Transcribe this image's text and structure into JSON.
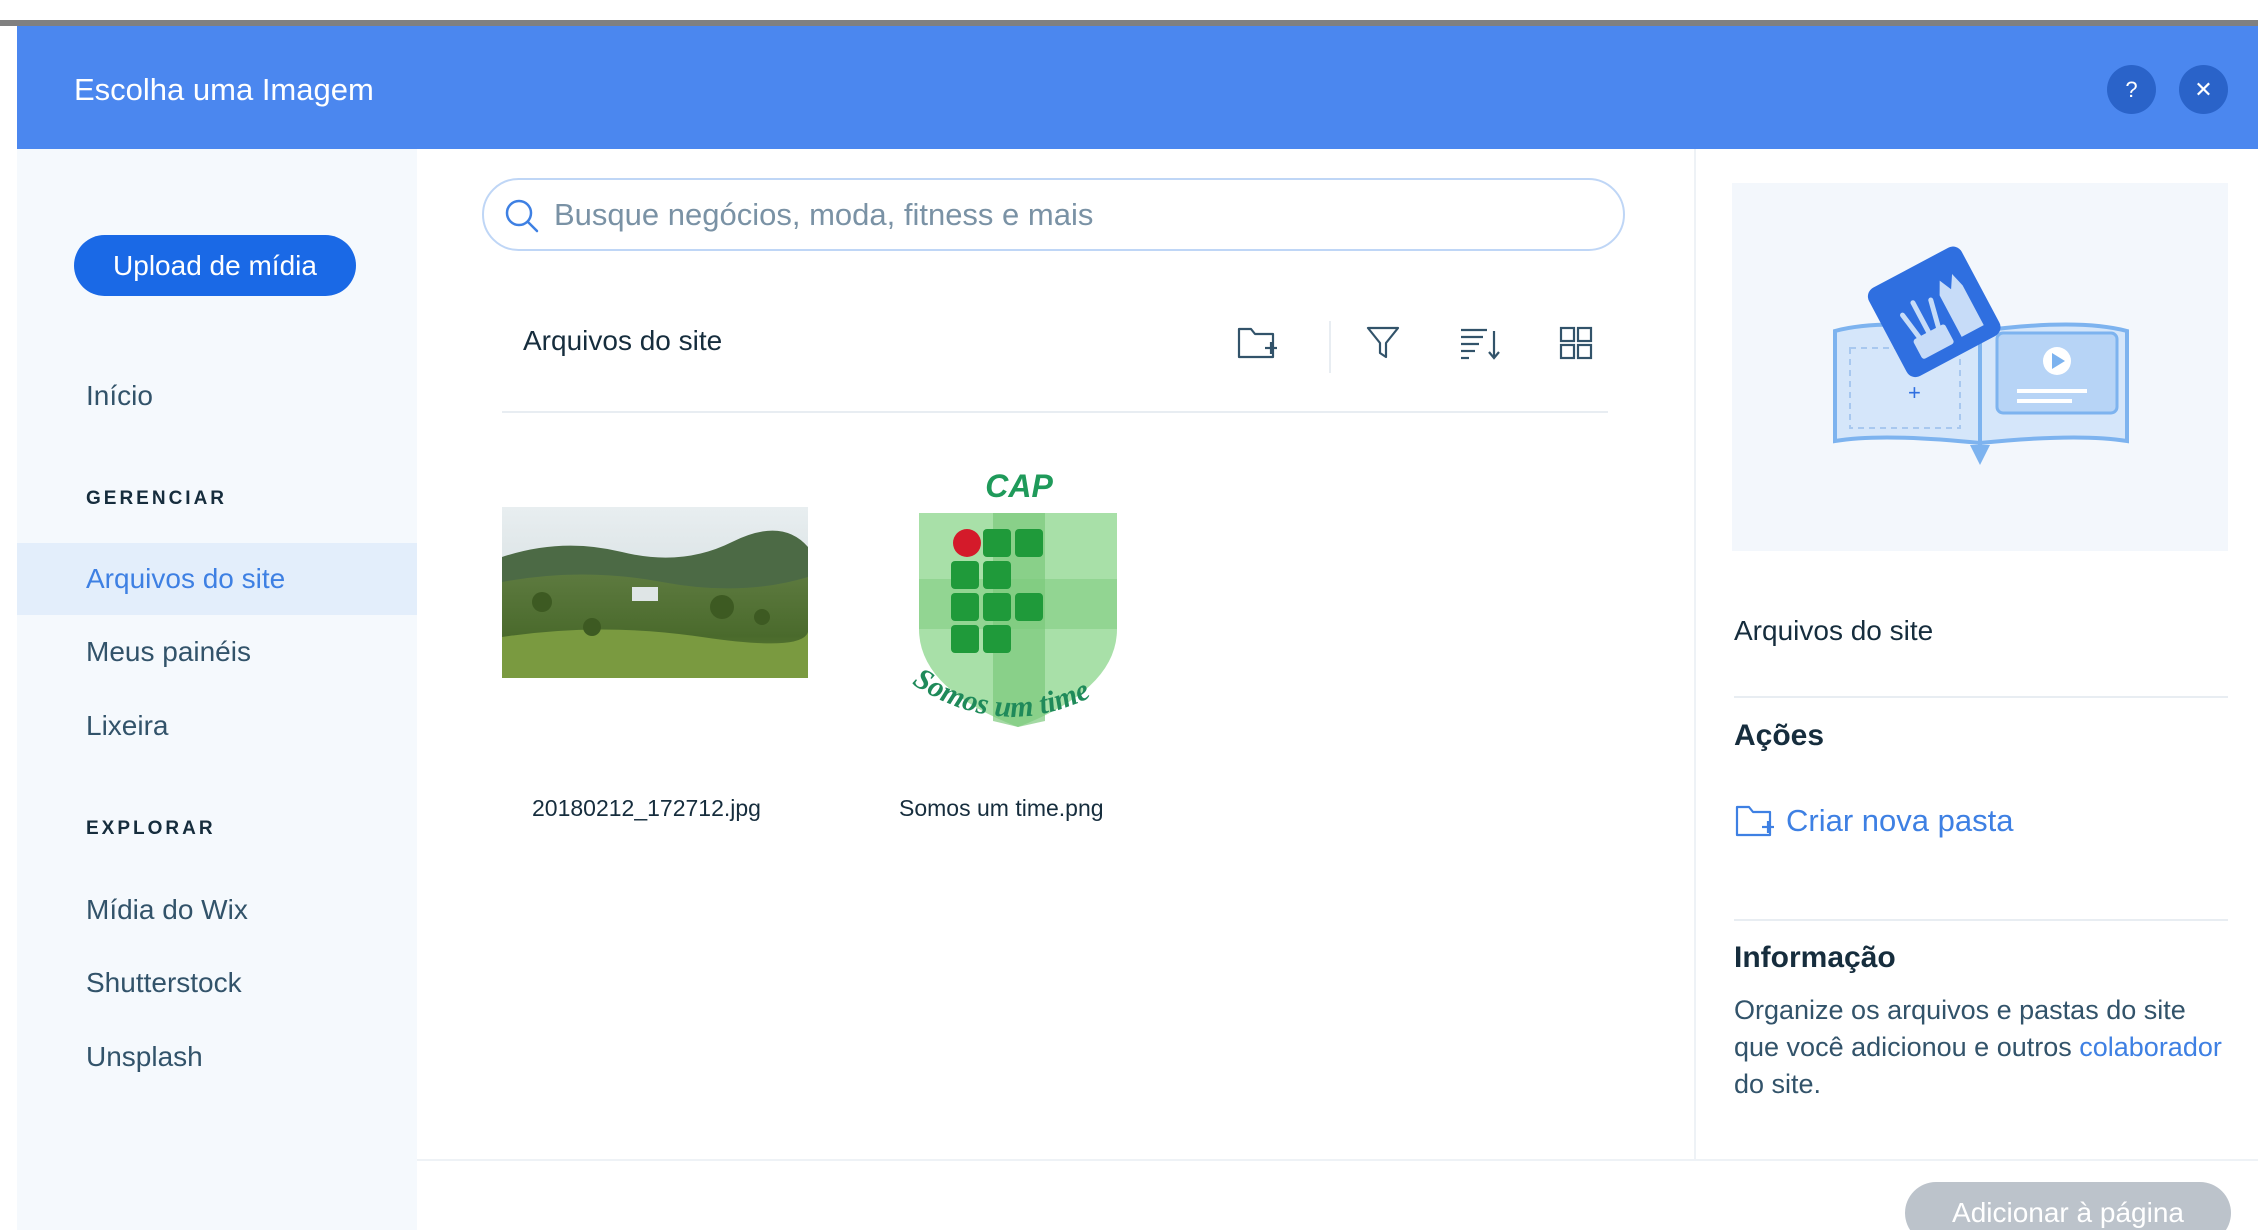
{
  "modal": {
    "title": "Escolha uma Imagem",
    "help_label": "?",
    "close_label": "✕"
  },
  "sidebar": {
    "upload_label": "Upload de mídia",
    "home_label": "Início",
    "manage_section": "GERENCIAR",
    "manage_items": [
      "Arquivos do site",
      "Meus painéis",
      "Lixeira"
    ],
    "explore_section": "EXPLORAR",
    "explore_items": [
      "Mídia do Wix",
      "Shutterstock",
      "Unsplash"
    ]
  },
  "search": {
    "placeholder": "Busque negócios, moda, fitness e mais",
    "value": ""
  },
  "center": {
    "breadcrumb": "Arquivos do site",
    "files": [
      {
        "name": "20180212_172712.jpg"
      },
      {
        "name": "Somos um time.png",
        "logo_top_text": "CAP",
        "logo_bottom_text": "Somos um time"
      }
    ]
  },
  "right_panel": {
    "folder_name": "Arquivos do site",
    "actions_heading": "Ações",
    "new_folder_label": "Criar nova pasta",
    "info_heading": "Informação",
    "info_text_before": "Organize os arquivos e pastas do site que você adicionou e outros ",
    "info_link": "colaborador",
    "info_text_after": " do site."
  },
  "footer": {
    "add_label": "Adicionar à página"
  },
  "colors": {
    "header": "#4b87ef",
    "primary": "#1a69e6",
    "link": "#3e80e3",
    "disabled": "#bcc3cb"
  }
}
